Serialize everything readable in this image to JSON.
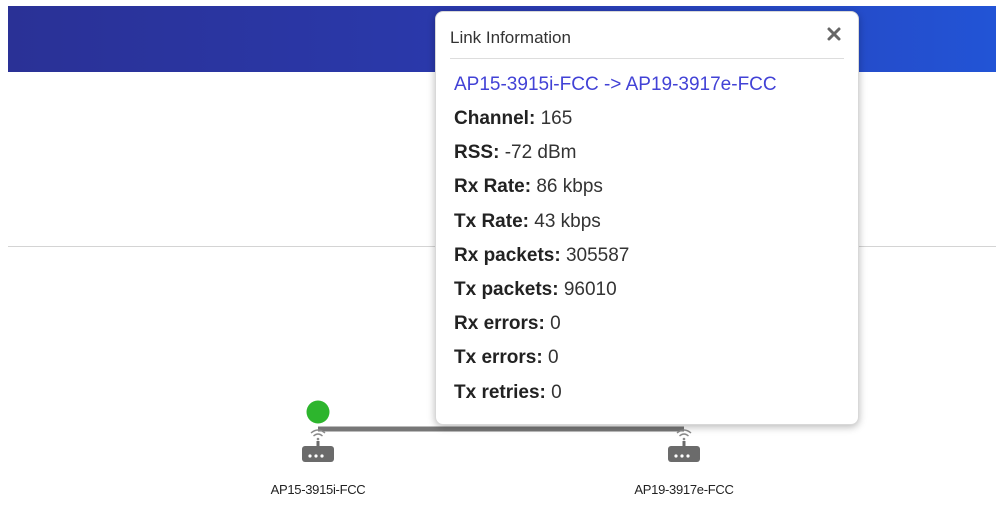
{
  "popup": {
    "title": "Link Information",
    "close_icon": "close-icon",
    "link": "AP15-3915i-FCC -> AP19-3917e-FCC",
    "stats": [
      {
        "label": "Channel:",
        "value": "165"
      },
      {
        "label": "RSS:",
        "value": "-72 dBm"
      },
      {
        "label": "Rx Rate:",
        "value": "86 kbps"
      },
      {
        "label": "Tx Rate:",
        "value": "43 kbps"
      },
      {
        "label": "Rx packets:",
        "value": "305587"
      },
      {
        "label": "Tx packets:",
        "value": "96010"
      },
      {
        "label": "Rx errors:",
        "value": "0"
      },
      {
        "label": "Tx errors:",
        "value": "0"
      },
      {
        "label": "Tx retries:",
        "value": "0"
      }
    ]
  },
  "topology": {
    "nodes": [
      {
        "name": "AP15-3915i-FCC",
        "icon": "access-point-icon",
        "status_icon": "online-status-dot"
      },
      {
        "name": "AP19-3917e-FCC",
        "icon": "access-point-icon"
      }
    ],
    "colors": {
      "header_start": "#2a3196",
      "header_end": "#2254d6",
      "link_line": "#777777",
      "status_online": "#2db52d",
      "ap_icon": "#6b6b6b",
      "link_text": "#4242d6"
    }
  }
}
